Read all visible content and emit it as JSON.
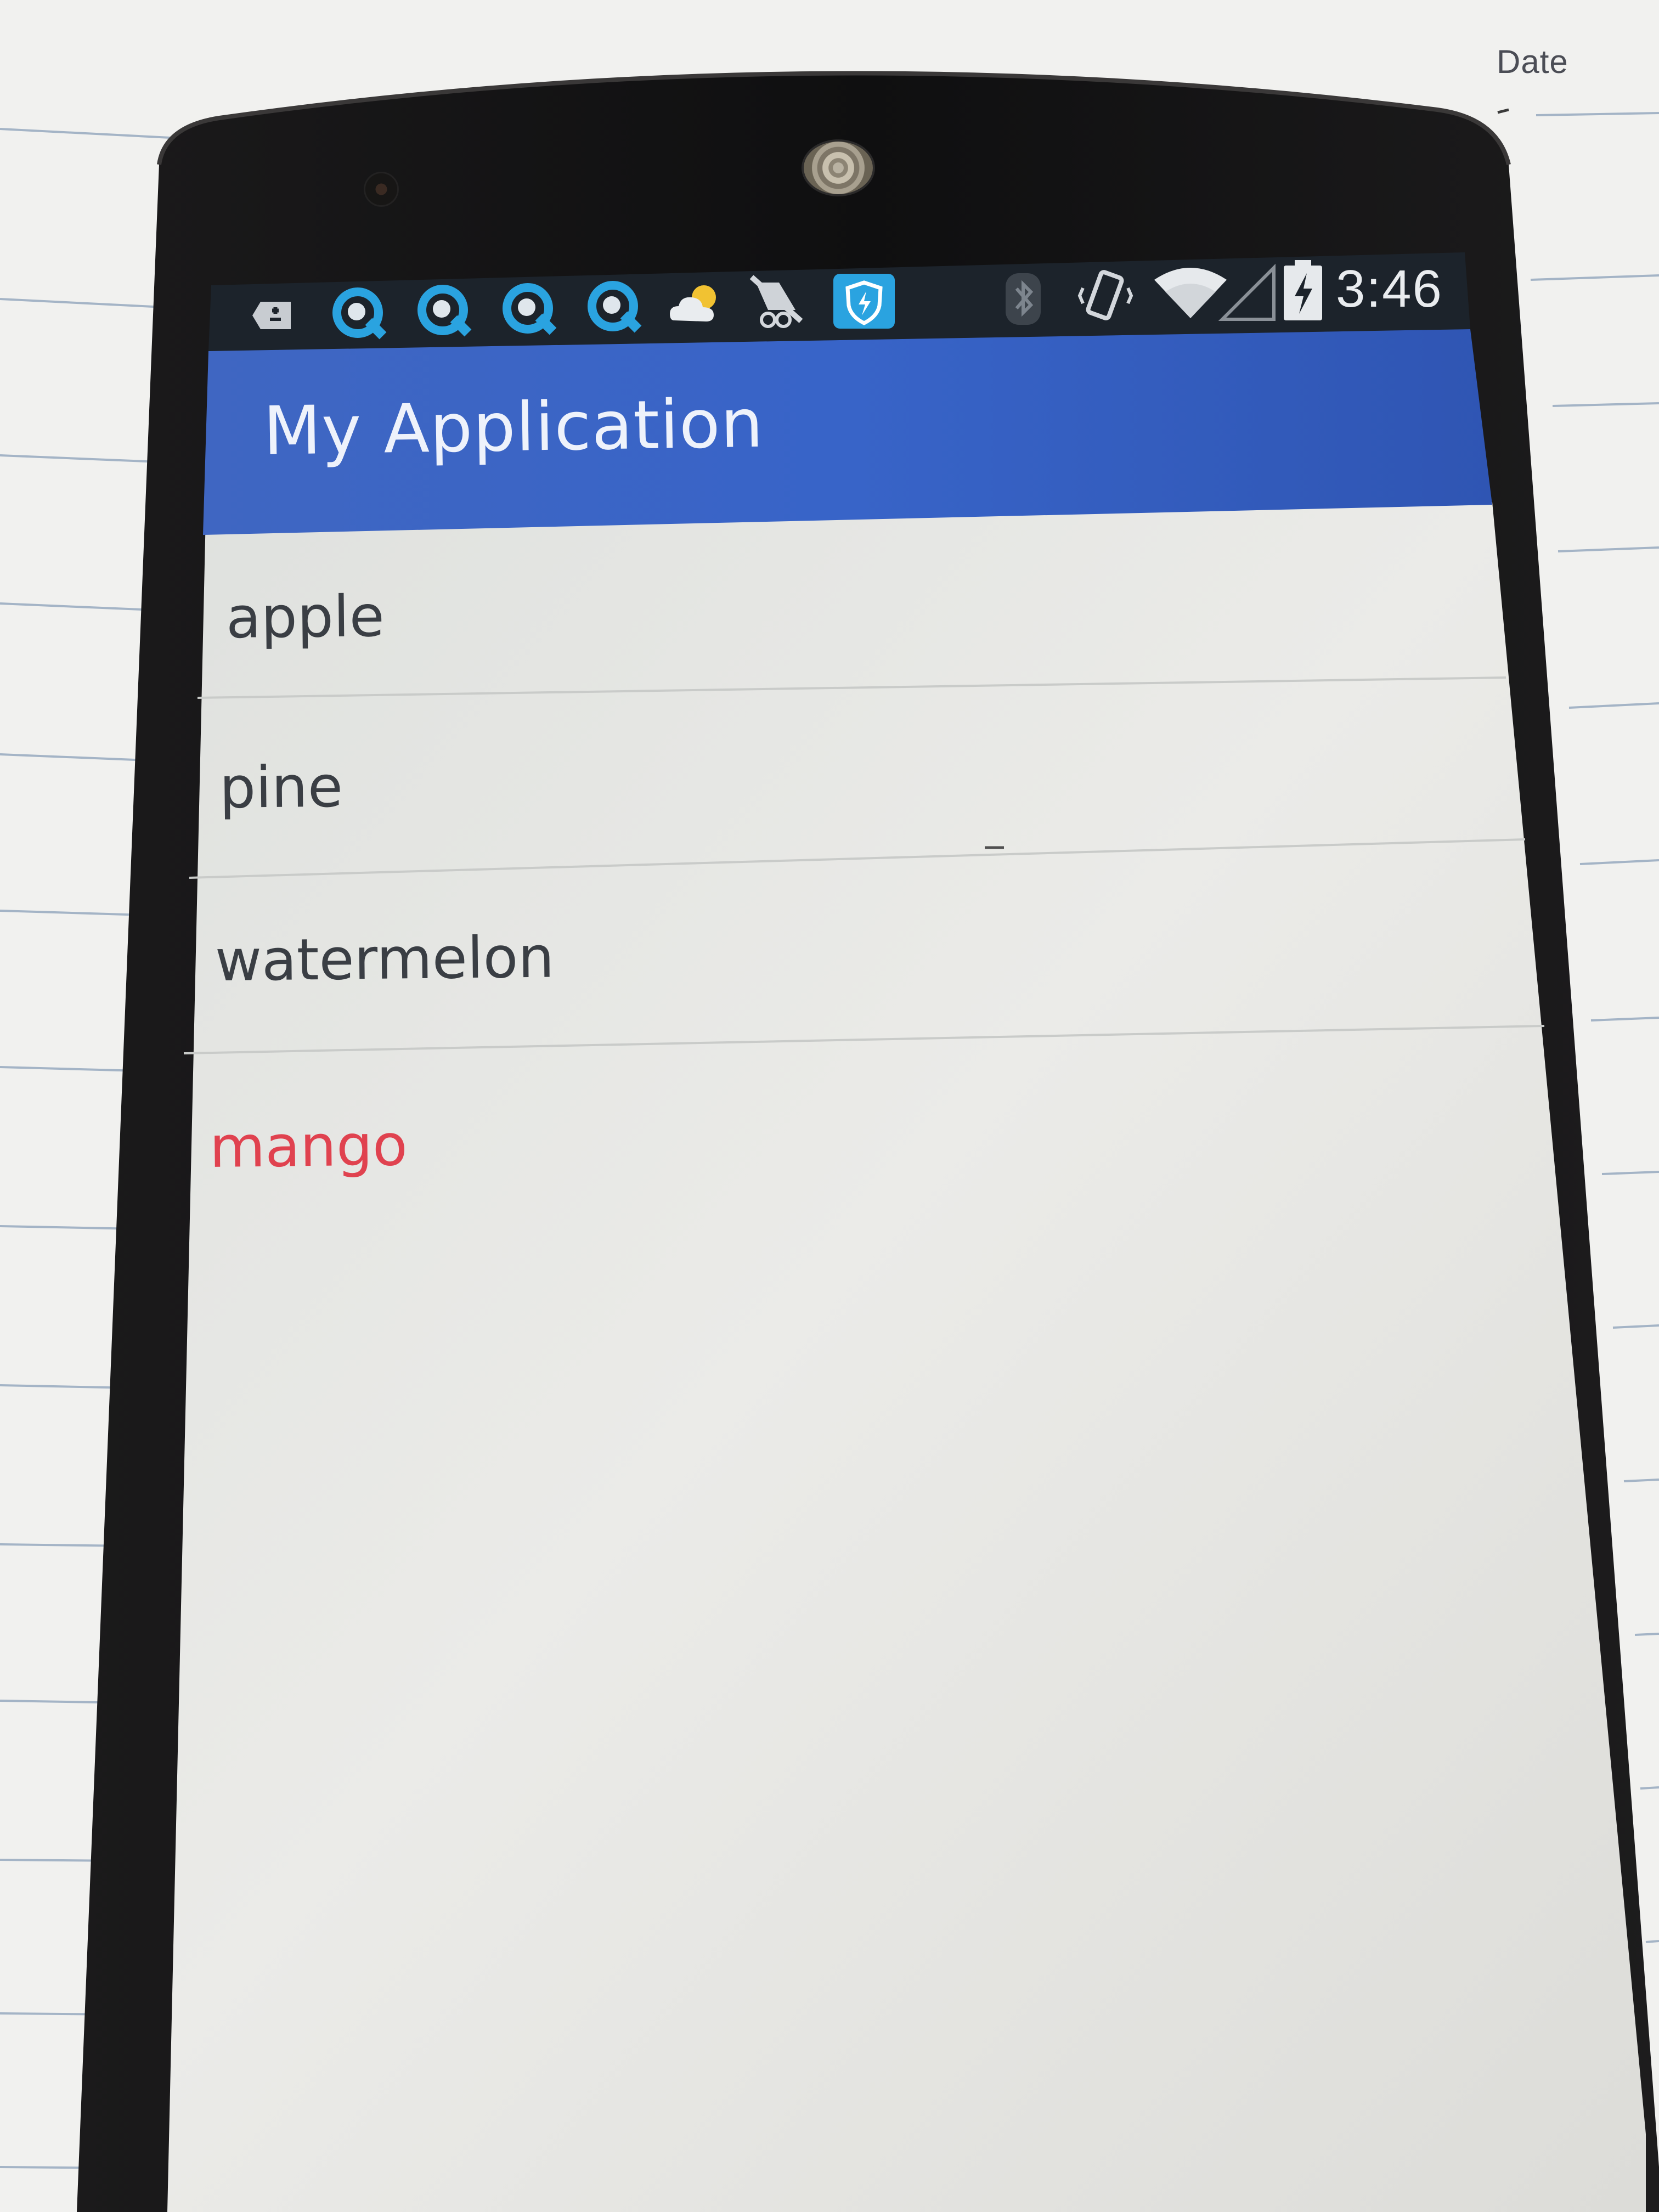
{
  "paper": {
    "date_label": "Date"
  },
  "status_bar": {
    "time": "3:46",
    "icons": [
      "messaging-icon",
      "app-notification-icon",
      "app-notification-icon",
      "app-notification-icon",
      "app-notification-icon",
      "weather-icon",
      "app-icon",
      "shield-icon",
      "bluetooth-icon",
      "vibrate-icon",
      "wifi-icon",
      "signal-icon",
      "battery-charging-icon"
    ]
  },
  "app_bar": {
    "title": "My Application",
    "color": "#3a66c4"
  },
  "list": {
    "items": [
      {
        "label": "apple",
        "selected": false
      },
      {
        "label": "pine",
        "selected": false
      },
      {
        "label": "watermelon",
        "selected": false
      },
      {
        "label": "mango",
        "selected": true
      }
    ],
    "text_color": "#3a3e44",
    "selected_color": "#e0424f"
  }
}
